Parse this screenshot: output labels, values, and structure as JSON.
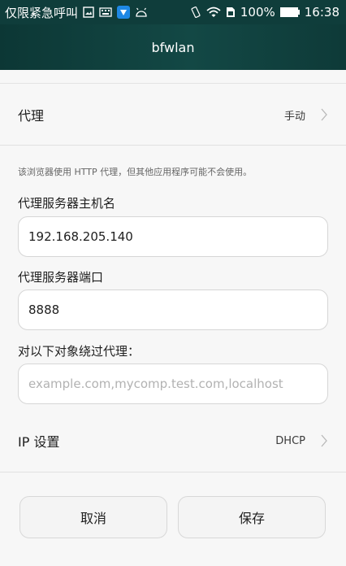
{
  "status_bar": {
    "left_text": "仅限紧急呼叫",
    "battery": "100%",
    "time": "16:38"
  },
  "title": "bfwlan",
  "proxy": {
    "label": "代理",
    "value": "手动"
  },
  "note": "该浏览器使用 HTTP 代理，但其他应用程序可能不会使用。",
  "host": {
    "label": "代理服务器主机名",
    "value": "192.168.205.140"
  },
  "port": {
    "label": "代理服务器端口",
    "value": "8888"
  },
  "bypass": {
    "label": "对以下对象绕过代理：",
    "placeholder": "example.com,mycomp.test.com,localhost"
  },
  "ip_settings": {
    "label": "IP 设置",
    "value": "DHCP"
  },
  "buttons": {
    "cancel": "取消",
    "save": "保存"
  }
}
